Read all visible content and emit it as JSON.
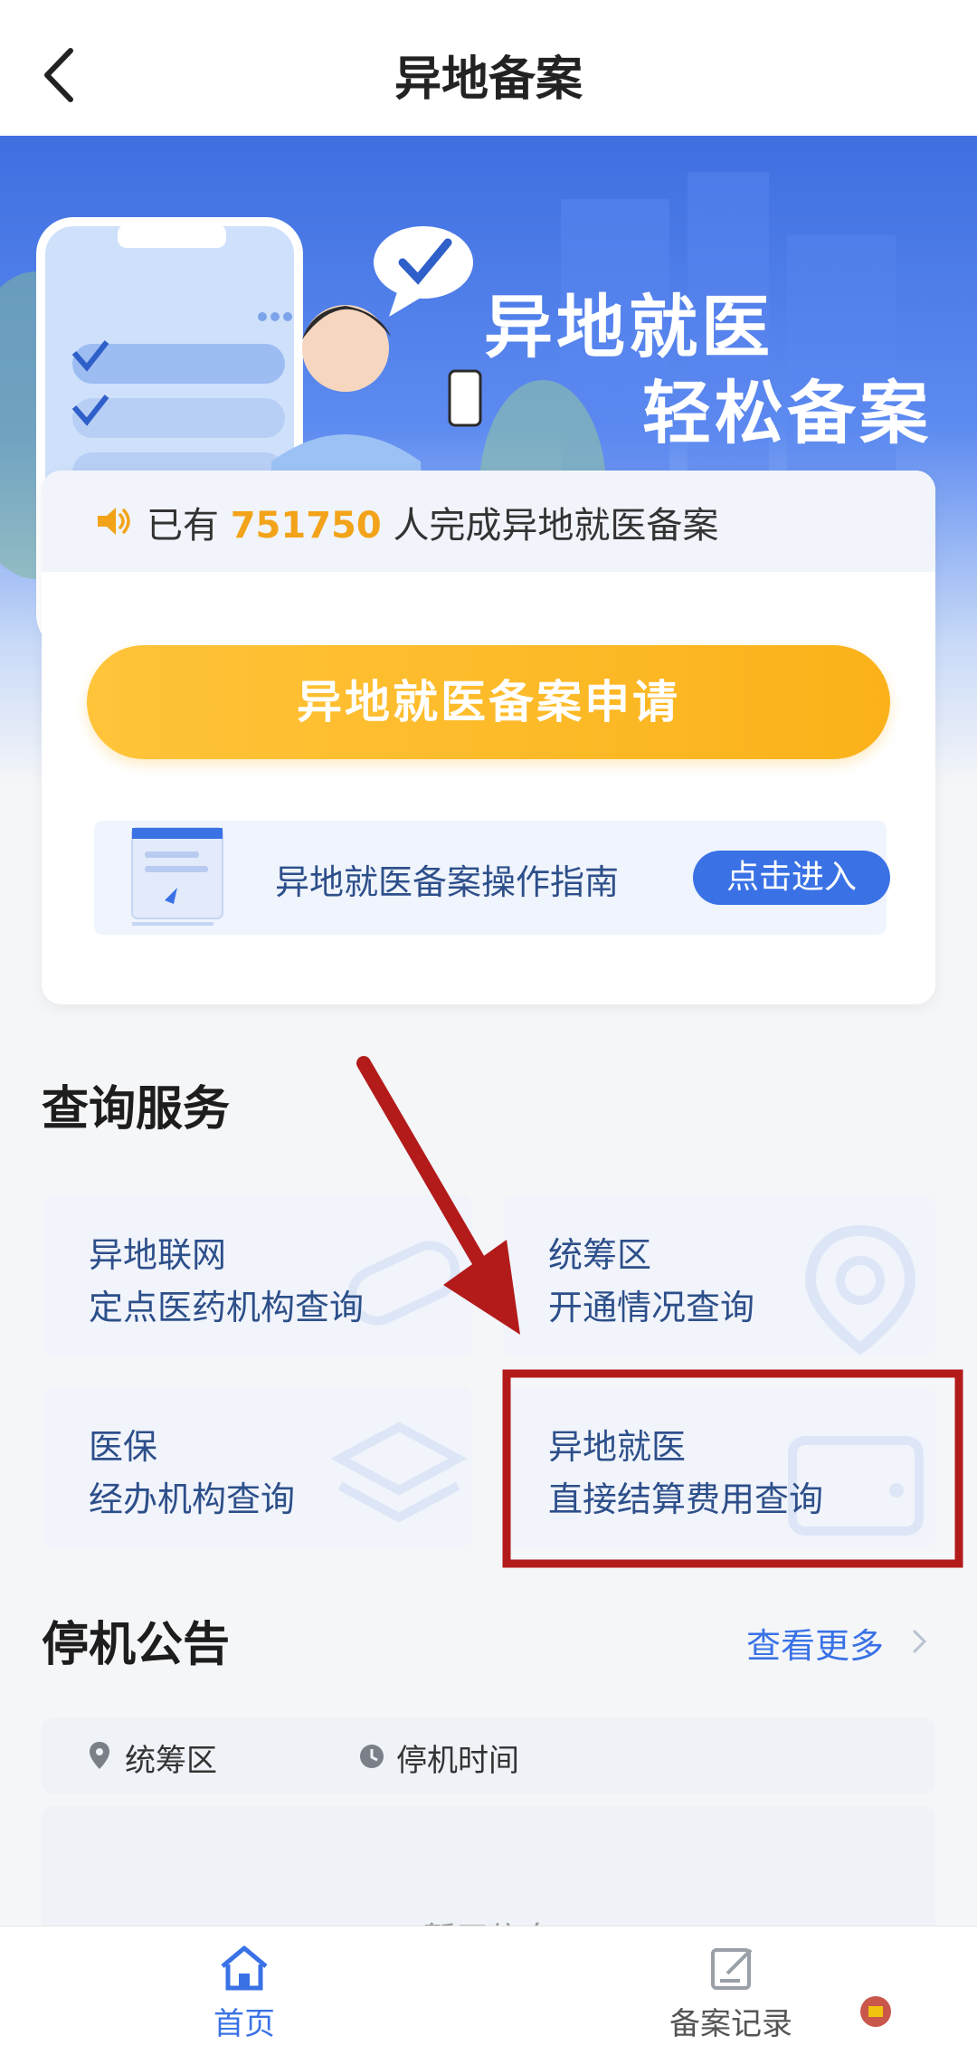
{
  "header": {
    "title": "异地备案"
  },
  "banner": {
    "slogan_line1": "异地就医",
    "slogan_line2": "轻松备案"
  },
  "notice": {
    "prefix": "已有",
    "count": "751750",
    "suffix": "人完成异地就医备案"
  },
  "apply_button": "异地就医备案申请",
  "guide": {
    "label": "异地就医备案操作指南",
    "button": "点击进入"
  },
  "query_section": {
    "title": "查询服务",
    "tiles": [
      {
        "line1": "异地联网",
        "line2": "定点医药机构查询"
      },
      {
        "line1": "统筹区",
        "line2": "开通情况查询"
      },
      {
        "line1": "医保",
        "line2": "经办机构查询"
      },
      {
        "line1": "异地就医",
        "line2": "直接结算费用查询"
      }
    ]
  },
  "announcement": {
    "title": "停机公告",
    "more": "查看更多",
    "columns": [
      "统筹区",
      "停机时间"
    ],
    "empty_text": "暂无信息"
  },
  "tabbar": {
    "items": [
      {
        "label": "首页"
      },
      {
        "label": "备案记录"
      }
    ]
  },
  "colors": {
    "primary": "#3a72e6",
    "accent": "#fbb21a",
    "annotation": "#b31b1b"
  }
}
